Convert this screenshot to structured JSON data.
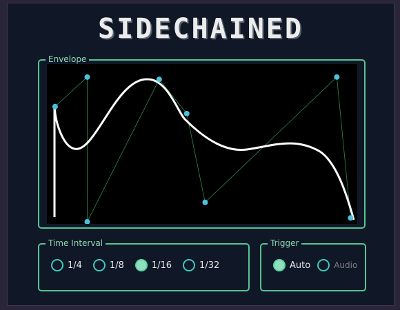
{
  "app": {
    "title": "SIDECHAINED"
  },
  "envelope": {
    "label": "Envelope",
    "points": [
      {
        "x": 0.02,
        "y": 0.26
      },
      {
        "x": 0.125,
        "y": 0.07
      },
      {
        "x": 0.125,
        "y": 1.0
      },
      {
        "x": 0.36,
        "y": 0.085
      },
      {
        "x": 0.45,
        "y": 0.305
      },
      {
        "x": 0.51,
        "y": 0.875
      },
      {
        "x": 0.94,
        "y": 0.07
      },
      {
        "x": 0.985,
        "y": 0.975
      }
    ]
  },
  "time_interval": {
    "label": "Time Interval",
    "selected": 2,
    "options": [
      "1/4",
      "1/8",
      "1/16",
      "1/32"
    ]
  },
  "trigger": {
    "label": "Trigger",
    "selected": 0,
    "options": [
      "Auto",
      "Audio"
    ]
  },
  "colors": {
    "accent": "#55c593",
    "handle": "#4cc0de",
    "curve": "#ffffff",
    "guide": "#2f8a4c"
  }
}
